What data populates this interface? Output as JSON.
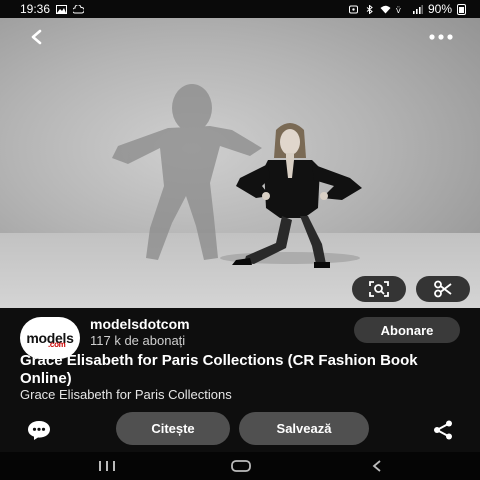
{
  "status_bar": {
    "time": "19:36",
    "battery": "90%",
    "icons": [
      "image-icon",
      "cloud-icon",
      "alarm-icon",
      "bluetooth-icon",
      "wifi-icon",
      "volte-icon",
      "signal-icon",
      "battery-icon"
    ]
  },
  "pin": {
    "image_description_icons": [
      "back-arrow-icon",
      "more-icon",
      "visual-search-icon",
      "scissors-icon"
    ]
  },
  "channel": {
    "logo_text": "models",
    "logo_sub": ".com",
    "name": "modelsdotcom",
    "subscribers": "117 k de abonați",
    "subscribe_label": "Abonare"
  },
  "title": "Grace Elisabeth for Paris Collections (CR Fashion Book Online)",
  "subtitle": "Grace Elisabeth for Paris Collections",
  "actions": {
    "read_label": "Citește",
    "save_label": "Salvează"
  },
  "colors": {
    "background": "#0e0e0e",
    "button": "#505050",
    "subscribe_button": "#3a3a3a"
  }
}
